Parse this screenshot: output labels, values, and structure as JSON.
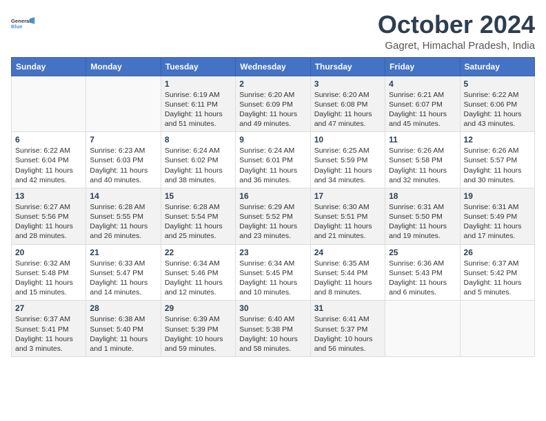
{
  "header": {
    "logo_line1": "General",
    "logo_line2": "Blue",
    "month_title": "October 2024",
    "subtitle": "Gagret, Himachal Pradesh, India"
  },
  "weekdays": [
    "Sunday",
    "Monday",
    "Tuesday",
    "Wednesday",
    "Thursday",
    "Friday",
    "Saturday"
  ],
  "weeks": [
    [
      {
        "day": "",
        "info": ""
      },
      {
        "day": "",
        "info": ""
      },
      {
        "day": "1",
        "info": "Sunrise: 6:19 AM\nSunset: 6:11 PM\nDaylight: 11 hours and 51 minutes."
      },
      {
        "day": "2",
        "info": "Sunrise: 6:20 AM\nSunset: 6:09 PM\nDaylight: 11 hours and 49 minutes."
      },
      {
        "day": "3",
        "info": "Sunrise: 6:20 AM\nSunset: 6:08 PM\nDaylight: 11 hours and 47 minutes."
      },
      {
        "day": "4",
        "info": "Sunrise: 6:21 AM\nSunset: 6:07 PM\nDaylight: 11 hours and 45 minutes."
      },
      {
        "day": "5",
        "info": "Sunrise: 6:22 AM\nSunset: 6:06 PM\nDaylight: 11 hours and 43 minutes."
      }
    ],
    [
      {
        "day": "6",
        "info": "Sunrise: 6:22 AM\nSunset: 6:04 PM\nDaylight: 11 hours and 42 minutes."
      },
      {
        "day": "7",
        "info": "Sunrise: 6:23 AM\nSunset: 6:03 PM\nDaylight: 11 hours and 40 minutes."
      },
      {
        "day": "8",
        "info": "Sunrise: 6:24 AM\nSunset: 6:02 PM\nDaylight: 11 hours and 38 minutes."
      },
      {
        "day": "9",
        "info": "Sunrise: 6:24 AM\nSunset: 6:01 PM\nDaylight: 11 hours and 36 minutes."
      },
      {
        "day": "10",
        "info": "Sunrise: 6:25 AM\nSunset: 5:59 PM\nDaylight: 11 hours and 34 minutes."
      },
      {
        "day": "11",
        "info": "Sunrise: 6:26 AM\nSunset: 5:58 PM\nDaylight: 11 hours and 32 minutes."
      },
      {
        "day": "12",
        "info": "Sunrise: 6:26 AM\nSunset: 5:57 PM\nDaylight: 11 hours and 30 minutes."
      }
    ],
    [
      {
        "day": "13",
        "info": "Sunrise: 6:27 AM\nSunset: 5:56 PM\nDaylight: 11 hours and 28 minutes."
      },
      {
        "day": "14",
        "info": "Sunrise: 6:28 AM\nSunset: 5:55 PM\nDaylight: 11 hours and 26 minutes."
      },
      {
        "day": "15",
        "info": "Sunrise: 6:28 AM\nSunset: 5:54 PM\nDaylight: 11 hours and 25 minutes."
      },
      {
        "day": "16",
        "info": "Sunrise: 6:29 AM\nSunset: 5:52 PM\nDaylight: 11 hours and 23 minutes."
      },
      {
        "day": "17",
        "info": "Sunrise: 6:30 AM\nSunset: 5:51 PM\nDaylight: 11 hours and 21 minutes."
      },
      {
        "day": "18",
        "info": "Sunrise: 6:31 AM\nSunset: 5:50 PM\nDaylight: 11 hours and 19 minutes."
      },
      {
        "day": "19",
        "info": "Sunrise: 6:31 AM\nSunset: 5:49 PM\nDaylight: 11 hours and 17 minutes."
      }
    ],
    [
      {
        "day": "20",
        "info": "Sunrise: 6:32 AM\nSunset: 5:48 PM\nDaylight: 11 hours and 15 minutes."
      },
      {
        "day": "21",
        "info": "Sunrise: 6:33 AM\nSunset: 5:47 PM\nDaylight: 11 hours and 14 minutes."
      },
      {
        "day": "22",
        "info": "Sunrise: 6:34 AM\nSunset: 5:46 PM\nDaylight: 11 hours and 12 minutes."
      },
      {
        "day": "23",
        "info": "Sunrise: 6:34 AM\nSunset: 5:45 PM\nDaylight: 11 hours and 10 minutes."
      },
      {
        "day": "24",
        "info": "Sunrise: 6:35 AM\nSunset: 5:44 PM\nDaylight: 11 hours and 8 minutes."
      },
      {
        "day": "25",
        "info": "Sunrise: 6:36 AM\nSunset: 5:43 PM\nDaylight: 11 hours and 6 minutes."
      },
      {
        "day": "26",
        "info": "Sunrise: 6:37 AM\nSunset: 5:42 PM\nDaylight: 11 hours and 5 minutes."
      }
    ],
    [
      {
        "day": "27",
        "info": "Sunrise: 6:37 AM\nSunset: 5:41 PM\nDaylight: 11 hours and 3 minutes."
      },
      {
        "day": "28",
        "info": "Sunrise: 6:38 AM\nSunset: 5:40 PM\nDaylight: 11 hours and 1 minute."
      },
      {
        "day": "29",
        "info": "Sunrise: 6:39 AM\nSunset: 5:39 PM\nDaylight: 10 hours and 59 minutes."
      },
      {
        "day": "30",
        "info": "Sunrise: 6:40 AM\nSunset: 5:38 PM\nDaylight: 10 hours and 58 minutes."
      },
      {
        "day": "31",
        "info": "Sunrise: 6:41 AM\nSunset: 5:37 PM\nDaylight: 10 hours and 56 minutes."
      },
      {
        "day": "",
        "info": ""
      },
      {
        "day": "",
        "info": ""
      }
    ]
  ]
}
